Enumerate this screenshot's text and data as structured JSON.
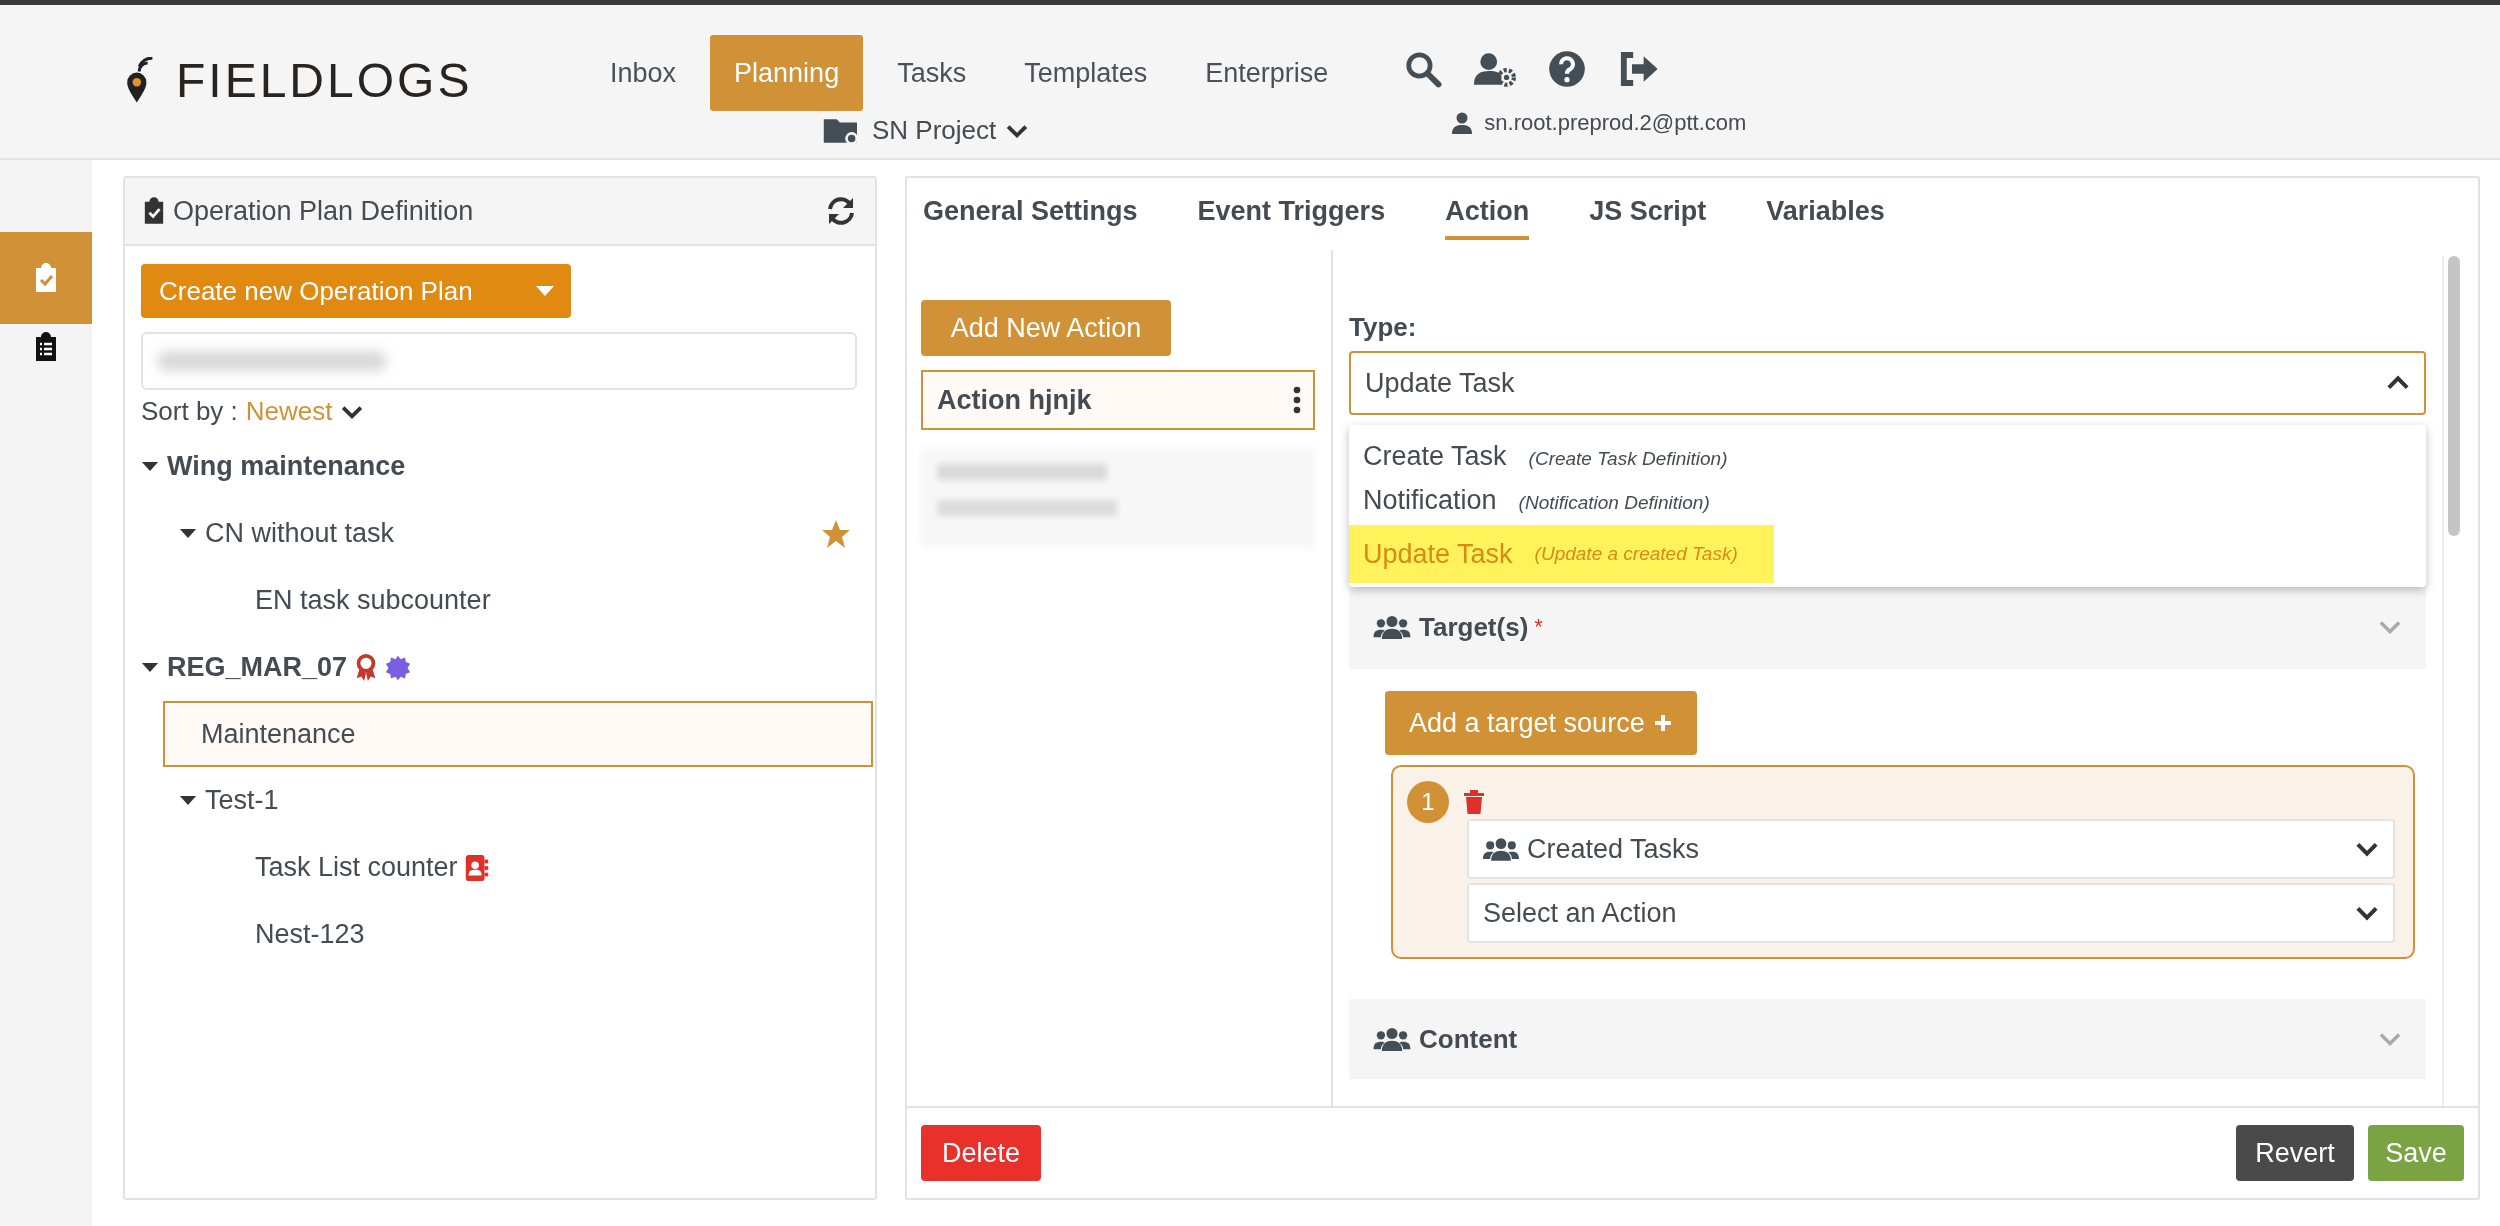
{
  "header": {
    "logo": "FIELDLOGS",
    "nav": [
      {
        "label": "Inbox",
        "selected": false
      },
      {
        "label": "Planning",
        "selected": true
      },
      {
        "label": "Tasks",
        "selected": false
      },
      {
        "label": "Templates",
        "selected": false
      },
      {
        "label": "Enterprise",
        "selected": false
      }
    ],
    "project": "SN Project",
    "user": "sn.root.preprod.2@ptt.com"
  },
  "rail": [
    {
      "kind": "plan",
      "selected": true
    },
    {
      "kind": "list",
      "selected": false
    }
  ],
  "left_panel": {
    "title": "Operation Plan Definition",
    "create_button": "Create new Operation Plan",
    "sort_label": "Sort by :",
    "sort_value": "Newest",
    "tree": [
      {
        "label": "Wing maintenance",
        "bold": true,
        "expanded": true,
        "selected": false,
        "starred": false,
        "children": [
          {
            "label": "CN without task",
            "bold": false,
            "expanded": true,
            "selected": false,
            "starred": true,
            "children": [
              {
                "label": "EN task subcounter",
                "bold": false,
                "selected": false,
                "starred": false
              }
            ]
          }
        ]
      },
      {
        "label": "REG_MAR_07",
        "bold": true,
        "expanded": true,
        "selected": false,
        "starred": false,
        "badges": [
          {
            "kind": "award"
          },
          {
            "kind": "seal"
          }
        ],
        "children": [
          {
            "label": "Maintenance",
            "bold": false,
            "selected": true,
            "starred": false
          },
          {
            "label": "Test-1",
            "bold": false,
            "expanded": true,
            "selected": false,
            "starred": false,
            "children": [
              {
                "label": "Task List counter",
                "bold": false,
                "selected": false,
                "starred": false,
                "badges": [
                  {
                    "kind": "contact"
                  }
                ]
              },
              {
                "label": "Nest-123",
                "bold": false,
                "selected": false,
                "starred": false
              }
            ]
          }
        ]
      }
    ]
  },
  "editor": {
    "tabs": [
      {
        "label": "General Settings",
        "selected": false
      },
      {
        "label": "Event Triggers",
        "selected": false
      },
      {
        "label": "Action",
        "selected": true
      },
      {
        "label": "JS Script",
        "selected": false
      },
      {
        "label": "Variables",
        "selected": false
      }
    ],
    "add_action_button": "Add New Action",
    "actions": [
      {
        "label": "Action hjnjk",
        "selected": true
      }
    ],
    "type_label": "Type:",
    "type_value": "Update Task",
    "type_expanded": true,
    "type_options": [
      {
        "label": "Create Task",
        "hint": "(Create Task Definition)",
        "selected": false
      },
      {
        "label": "Notification",
        "hint": "(Notification Definition)",
        "selected": false
      },
      {
        "label": "Update Task",
        "hint": "(Update a created Task)",
        "selected": true
      }
    ],
    "targets_section": {
      "title": "Target(s)",
      "required_mark": "*",
      "add_button": "Add a target source",
      "sources": [
        {
          "number": "1",
          "source": "Created Tasks",
          "action_placeholder": "Select an Action"
        }
      ]
    },
    "content_section": {
      "title": "Content",
      "expanded": false
    },
    "delete_button": "Delete",
    "revert_button": "Revert",
    "save_button": "Save"
  }
}
